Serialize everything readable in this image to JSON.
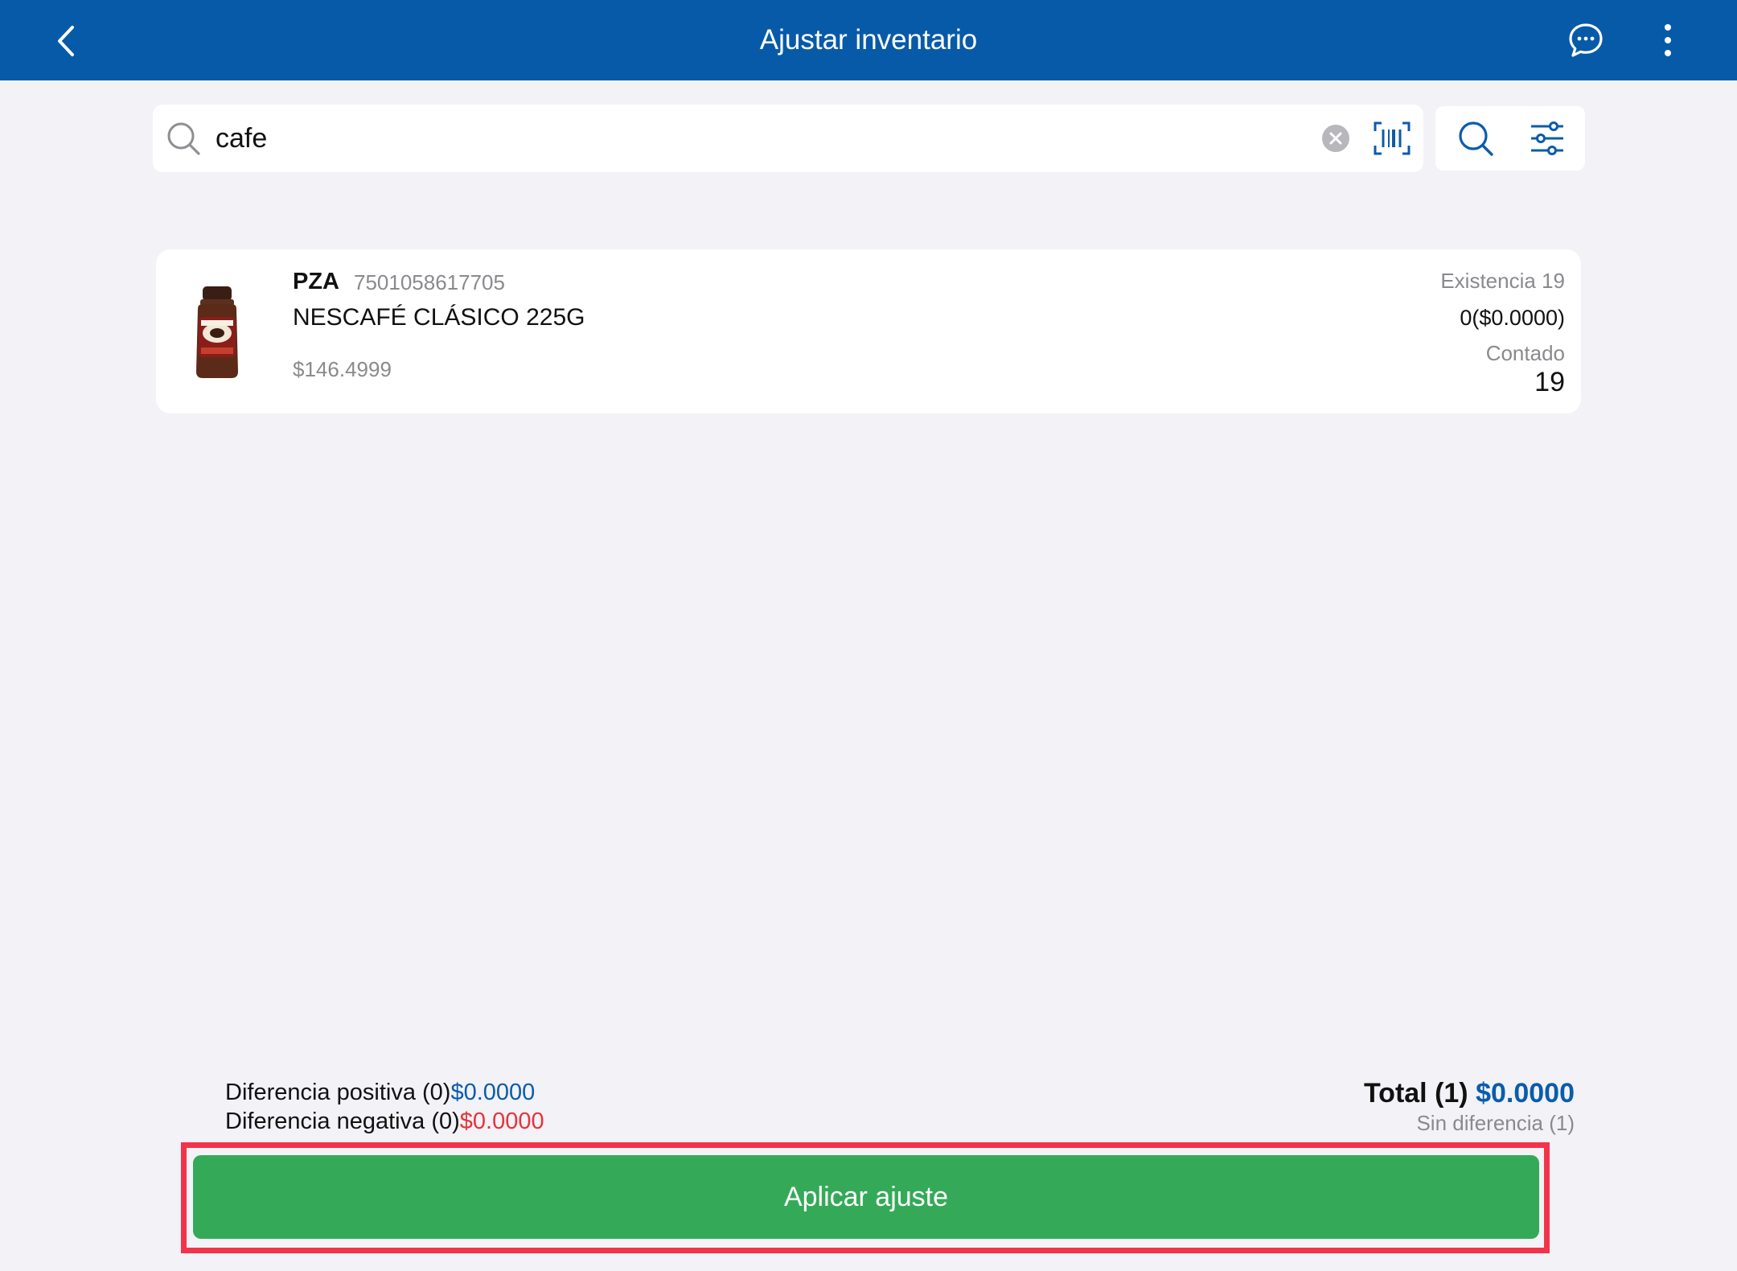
{
  "header": {
    "title": "Ajustar inventario",
    "back_icon": "chevron-left-icon",
    "chat_icon": "chat-bubble-icon",
    "more_icon": "more-vertical-icon"
  },
  "search": {
    "value": "cafe",
    "placeholder": "",
    "clear_icon": "clear-circle-icon",
    "barcode_icon": "barcode-scan-icon",
    "search_button_icon": "search-icon",
    "filter_icon": "sliders-icon"
  },
  "product": {
    "unit": "PZA",
    "barcode": "7501058617705",
    "name": "NESCAFÉ CLÁSICO 225G",
    "price": "$146.4999",
    "existencia": "Existencia 19",
    "difference": "0($0.0000)",
    "contado_label": "Contado",
    "contado_value": "19",
    "image_icon": "coffee-jar-image"
  },
  "summary": {
    "positive_label": "Diferencia positiva (0)",
    "positive_amount": "$0.0000",
    "negative_label": "Diferencia negativa (0)",
    "negative_amount": "$0.0000",
    "total_label": "Total (1)",
    "total_amount": "$0.0000",
    "sin_diferencia": "Sin diferencia (1)"
  },
  "actions": {
    "apply_label": "Aplicar ajuste"
  },
  "colors": {
    "header_bg": "#075aa8",
    "page_bg": "#f2f2f7",
    "accent_blue": "#0b5cab",
    "negative_red": "#e5343a",
    "apply_green": "#34aa58",
    "highlight_red": "#f2334a"
  }
}
